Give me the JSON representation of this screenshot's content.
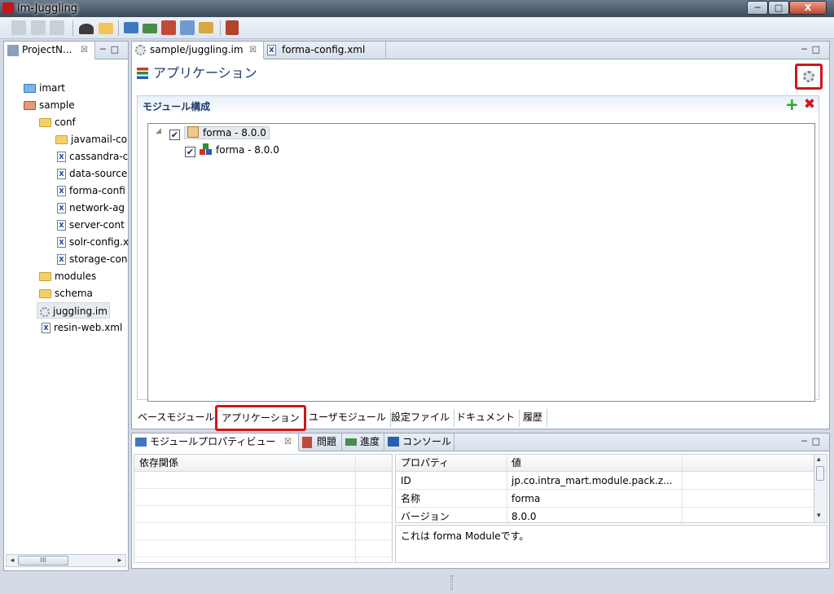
{
  "window": {
    "title": "im-Juggling",
    "minimize": "─",
    "maximize": "□",
    "close": "X"
  },
  "toolbar": {
    "icons": [
      "save-icon",
      "save-as-icon",
      "save-all-icon",
      "build-icon",
      "open-folder-icon",
      "monitor-icon",
      "export-icon",
      "import-icon",
      "image-icon",
      "tree-icon",
      "tools-icon"
    ]
  },
  "explorer": {
    "tab_label": "ProjectN...",
    "close": "☒",
    "minmax": "─□",
    "items": [
      {
        "label": "imart",
        "icon": "folder-blue-icon"
      },
      {
        "label": "sample",
        "icon": "folder-red-icon"
      },
      {
        "label": "conf",
        "icon": "folder-icon"
      },
      {
        "label": "javamail-co",
        "icon": "folder-icon"
      },
      {
        "label": "cassandra-c",
        "icon": "xml-file-icon"
      },
      {
        "label": "data-source",
        "icon": "xml-file-icon"
      },
      {
        "label": "forma-confi",
        "icon": "xml-file-icon"
      },
      {
        "label": "network-ag",
        "icon": "xml-file-icon"
      },
      {
        "label": "server-cont",
        "icon": "xml-file-icon"
      },
      {
        "label": "solr-config.x",
        "icon": "xml-file-icon"
      },
      {
        "label": "storage-con",
        "icon": "xml-file-icon"
      },
      {
        "label": "modules",
        "icon": "folder-icon"
      },
      {
        "label": "schema",
        "icon": "folder-icon"
      },
      {
        "label": "juggling.im",
        "icon": "gear-file-icon"
      },
      {
        "label": "resin-web.xml",
        "icon": "xml-file-icon"
      }
    ],
    "scroll_thumb": "III",
    "scroll_left": "◂",
    "scroll_right": "▸"
  },
  "editor": {
    "tabs": [
      {
        "label": "sample/juggling.im",
        "close": "☒"
      },
      {
        "label": "forma-config.xml"
      }
    ],
    "minmax": "─□",
    "title": "アプリケーション",
    "section_title": "モジュール構成",
    "add_label": "+",
    "delete_label": "✖",
    "modules": [
      {
        "label": "forma - 8.0.0",
        "checked": "✔",
        "expander": "◢"
      },
      {
        "label": "forma - 8.0.0",
        "checked": "✔"
      }
    ],
    "bottom_tabs": [
      "ベースモジュール",
      "アプリケーション",
      "ユーザモジュール",
      "設定ファイル",
      "ドキュメント",
      "履歴"
    ]
  },
  "props_view": {
    "tabs": [
      {
        "label": "モジュールプロパティビュー",
        "close": "☒"
      },
      {
        "label": "問題"
      },
      {
        "label": "進度"
      },
      {
        "label": "コンソール"
      }
    ],
    "minmax": "─□",
    "dependency_header": "依存関係",
    "property_header": "プロパティ",
    "value_header": "値",
    "properties": [
      {
        "name": "ID",
        "value": "jp.co.intra_mart.module.pack.z..."
      },
      {
        "name": "名称",
        "value": "forma"
      },
      {
        "name": "バージョン",
        "value": "8.0.0"
      }
    ],
    "description": "これは forma Moduleです。",
    "scroll_up": "▴",
    "scroll_down": "▾"
  }
}
